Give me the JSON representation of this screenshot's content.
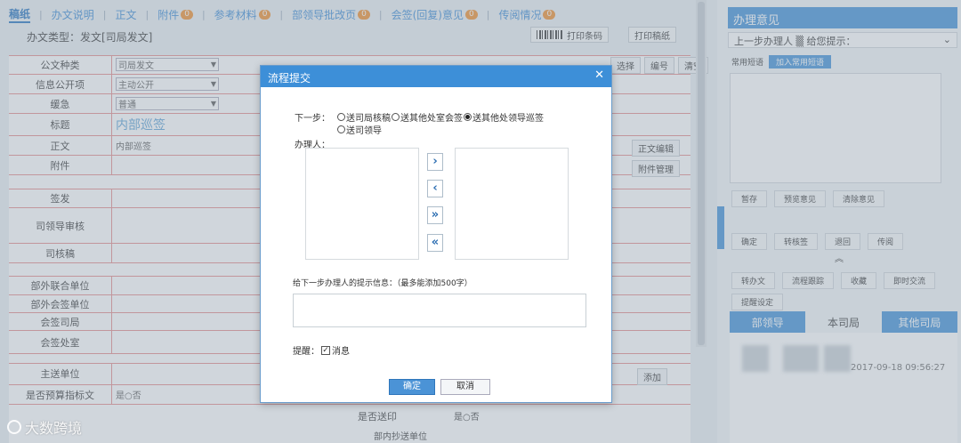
{
  "tabs": [
    {
      "label": "稿纸",
      "badge": ""
    },
    {
      "label": "办文说明",
      "badge": ""
    },
    {
      "label": "正文",
      "badge": ""
    },
    {
      "label": "附件",
      "badge": "0"
    },
    {
      "label": "参考材料",
      "badge": "0"
    },
    {
      "label": "部领导批改页",
      "badge": "0"
    },
    {
      "label": "会签(回复)意见",
      "badge": "0"
    },
    {
      "label": "传阅情况",
      "badge": "0"
    }
  ],
  "doc_type": "办文类型：发文[司局发文]",
  "toolbar": {
    "print_barcode": "打印条码",
    "print_draft": "打印稿纸"
  },
  "form": {
    "top_tools": [
      "选择",
      "编号",
      "清空"
    ],
    "rows": [
      {
        "label": "公文种类",
        "value": "司局发文"
      },
      {
        "label": "信息公开项",
        "value": "主动公开"
      },
      {
        "label": "缓急",
        "value": "普通"
      },
      {
        "label": "标题",
        "value": "内部巡签"
      },
      {
        "label": "正文",
        "value": "内部巡签"
      },
      {
        "label": "附件",
        "value": ""
      },
      {
        "label": "签发",
        "value": ""
      },
      {
        "label": "司领导审核",
        "value": ""
      },
      {
        "label": "司核稿",
        "value": ""
      },
      {
        "label": "部外联合单位",
        "value": ""
      },
      {
        "label": "部外会签单位",
        "value": ""
      },
      {
        "label": "会签司局",
        "value": ""
      },
      {
        "label": "会签处室",
        "value": ""
      },
      {
        "label": "主送单位",
        "value": ""
      },
      {
        "label": "是否预算指标文",
        "value": "是○否"
      }
    ],
    "doc_edit": "正文编辑",
    "attach_manage": "附件管理",
    "add": "添加",
    "send_print": "是否送印",
    "send_print_val": "是○否",
    "dept_unit": "部内抄送单位"
  },
  "right_panel": {
    "header": "办理意见",
    "prev_handler": "上一步办理人",
    "prompt": "给您提示：",
    "common_phrases": "常用短语",
    "add_phrase": "加入常用短语",
    "buttons_row1": [
      "暂存",
      "预览意见",
      "清除意见"
    ],
    "buttons_row2": [
      "确定",
      "转核签",
      "退回",
      "传阅"
    ],
    "buttons_row3": [
      "转办文",
      "流程跟踪",
      "收藏",
      "即时交流"
    ],
    "buttons_row4": [
      "提醒设定"
    ],
    "tabs": [
      "部领导",
      "本司局",
      "其他司局"
    ],
    "timestamp": "2017-09-18 09:56:27"
  },
  "dialog": {
    "title": "流程提交",
    "next_step_label": "下一步：",
    "options": [
      {
        "label": "送司局核稿",
        "selected": false
      },
      {
        "label": "送其他处室会签",
        "selected": false
      },
      {
        "label": "送其他处领导巡签",
        "selected": true
      },
      {
        "label": "送司领导",
        "selected": false
      }
    ],
    "handler_label": "办理人：",
    "move_buttons": [
      "›",
      "‹",
      "»",
      "«"
    ],
    "hint_label": "给下一步办理人的提示信息：（最多能添加500字）",
    "remind_label": "提醒：",
    "remind_option": "消息",
    "remind_checked": true,
    "ok": "确定",
    "cancel": "取消"
  },
  "watermark": "大数跨境"
}
